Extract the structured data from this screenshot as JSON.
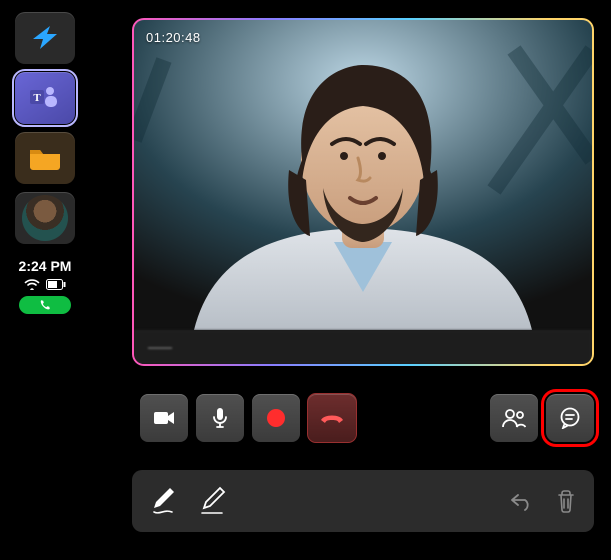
{
  "sidebar": {
    "apps": [
      {
        "name": "power-app",
        "icon": "power-icon"
      },
      {
        "name": "teams-app",
        "icon": "teams-icon",
        "selected": true
      },
      {
        "name": "files-app",
        "icon": "folder-icon"
      },
      {
        "name": "contact-avatar",
        "icon": "avatar"
      }
    ],
    "clock": "2:24 PM",
    "wifi": "wifi-full",
    "battery": "battery-mid",
    "call_pill_icon": "phone-icon"
  },
  "video": {
    "timer": "01:20:48",
    "participant_name": "——"
  },
  "call_controls": {
    "camera": "camera-icon",
    "mic": "mic-icon",
    "record": "record-icon",
    "hangup": "hangup-icon",
    "people": "people-icon",
    "chat": "chat-icon"
  },
  "ink_toolbar": {
    "pen": "pen-icon",
    "pencil": "pencil-icon",
    "undo": "undo-icon",
    "delete": "trash-icon"
  },
  "colors": {
    "accent": "#6966d6",
    "record": "#ff2d2d",
    "call_green": "#0fbd42",
    "highlight": "#ff0000"
  }
}
